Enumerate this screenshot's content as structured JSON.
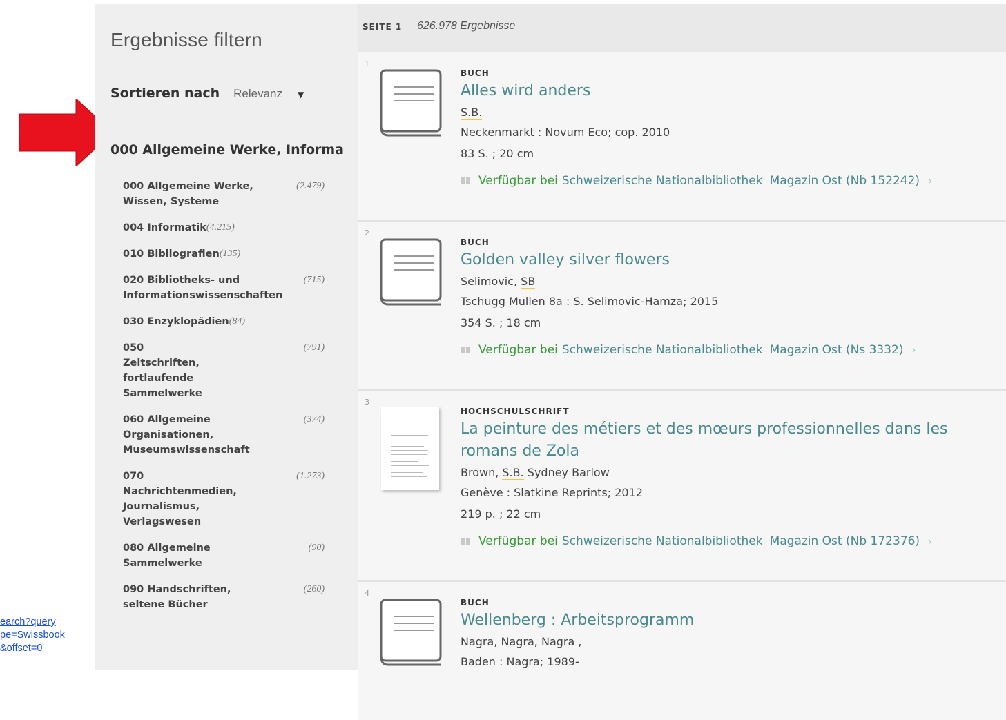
{
  "url_fragment": "earch?query\npe=Swissbook\n&offset=0",
  "filter": {
    "title": "Ergebnisse filtern",
    "sort_label": "Sortieren nach",
    "sort_value": "Relevanz",
    "facet_heading": "000 Allgemeine Werke, Informa",
    "facets": [
      {
        "label": "000 Allgemeine Werke, Wissen, Systeme",
        "count": "(2.479)"
      },
      {
        "label": "004 Informatik",
        "count": "(4.215)"
      },
      {
        "label": "010 Bibliografien",
        "count": "(135)"
      },
      {
        "label": "020 Bibliotheks- und Informationswissenschaften",
        "count": "(715)"
      },
      {
        "label": "030 Enzyklopädien",
        "count": "(84)"
      },
      {
        "label": "050 Zeitschriften, fortlaufende Sammelwerke",
        "count": "(791)"
      },
      {
        "label": "060 Allgemeine Organisationen, Museumswissenschaft",
        "count": "(374)"
      },
      {
        "label": "070 Nachrichtenmedien, Journalismus, Verlagswesen",
        "count": "(1.273)"
      },
      {
        "label": "080 Allgemeine Sammelwerke",
        "count": "(90)"
      },
      {
        "label": "090 Handschriften, seltene Bücher",
        "count": "(260)"
      }
    ]
  },
  "results_header": {
    "page_label": "SEITE 1",
    "count_text": "626.978 Ergebnisse"
  },
  "results": [
    {
      "index": "1",
      "type": "BUCH",
      "title": "Alles wird anders",
      "author_pre": "",
      "author_hl": "S.B.",
      "author_post": "",
      "publisher": "Neckenmarkt : Novum Eco; cop. 2010",
      "extent": "83 S. ; 20 cm",
      "availability_status": "Verfügbar bei",
      "library": "Schweizerische Nationalbibliothek",
      "location": "Magazin Ost (Nb 152242)"
    },
    {
      "index": "2",
      "type": "BUCH",
      "title": "Golden valley silver flowers",
      "author_pre": "Selimovic, ",
      "author_hl": "SB",
      "author_post": "",
      "publisher": "Tschugg Mullen 8a : S. Selimovic-Hamza; 2015",
      "extent": "354 S. ; 18 cm",
      "availability_status": "Verfügbar bei",
      "library": "Schweizerische Nationalbibliothek",
      "location": "Magazin Ost (Ns 3332)"
    },
    {
      "index": "3",
      "type": "HOCHSCHULSCHRIFT",
      "title": "La peinture des métiers et des mœurs professionnelles dans les romans de Zola",
      "author_pre": "Brown, ",
      "author_hl": "S.B.",
      "author_post": " Sydney Barlow",
      "publisher": "Genève : Slatkine Reprints; 2012",
      "extent": "219 p. ; 22 cm",
      "availability_status": "Verfügbar bei",
      "library": "Schweizerische Nationalbibliothek",
      "location": "Magazin Ost (Nb 172376)"
    },
    {
      "index": "4",
      "type": "BUCH",
      "title": "Wellenberg : Arbeitsprogramm",
      "author_pre": "Nagra, Nagra, Nagra ,",
      "author_hl": "",
      "author_post": "",
      "publisher": "Baden : Nagra; 1989-",
      "extent": "",
      "availability_status": "",
      "library": "",
      "location": ""
    }
  ],
  "colors": {
    "accent_title": "#4a8a8f",
    "available_green": "#3a9a3a",
    "arrow_red": "#e8121e",
    "panel_bg": "#efefef"
  }
}
